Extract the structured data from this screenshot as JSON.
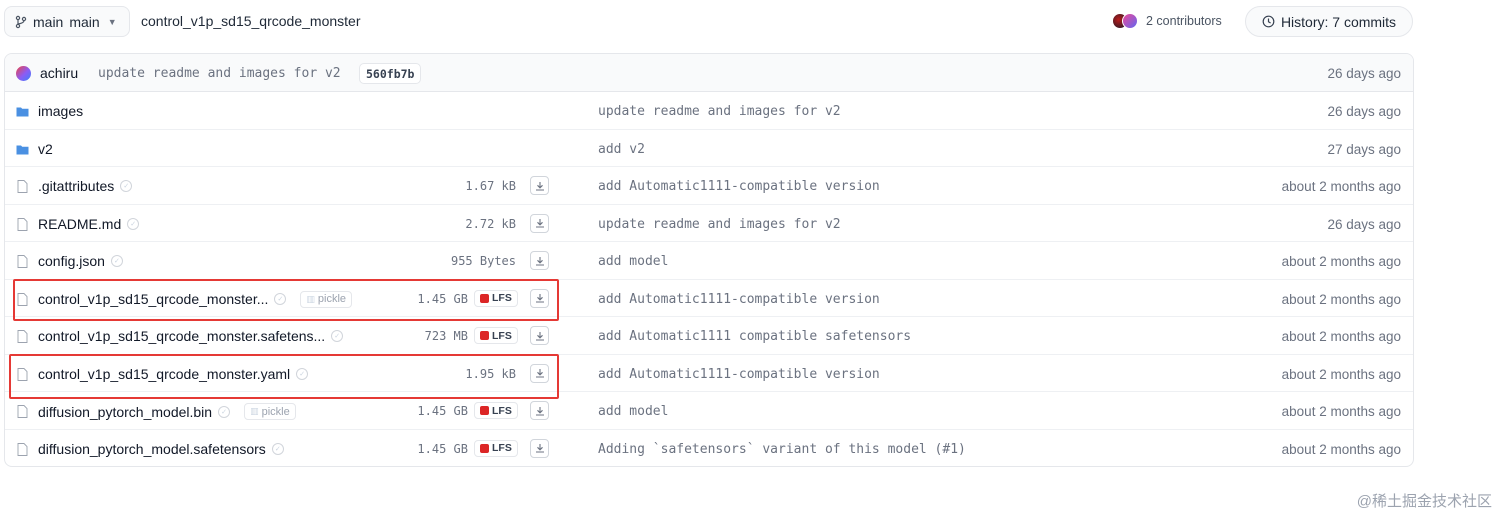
{
  "header": {
    "branch_label": "main",
    "repo_path": "control_v1p_sd15_qrcode_monster",
    "contributors_label": "2 contributors",
    "history_label": "History: 7 commits"
  },
  "last_commit": {
    "author": "achiru",
    "message": "update readme and images for v2",
    "hash": "560fb7b",
    "date": "26 days ago"
  },
  "files": [
    {
      "type": "folder",
      "name": "images",
      "message": "update readme and images for v2",
      "date": "26 days ago"
    },
    {
      "type": "folder",
      "name": "v2",
      "message": "add v2",
      "date": "27 days ago"
    },
    {
      "type": "file",
      "name": ".gitattributes",
      "size": "1.67 kB",
      "message": "add Automatic1111-compatible version",
      "date": "about 2 months ago"
    },
    {
      "type": "file",
      "name": "README.md",
      "size": "2.72 kB",
      "message": "update readme and images for v2",
      "date": "26 days ago"
    },
    {
      "type": "file",
      "name": "config.json",
      "size": "955 Bytes",
      "message": "add model",
      "date": "about 2 months ago"
    },
    {
      "type": "file",
      "name": "control_v1p_sd15_qrcode_monster...",
      "pickle": "pickle",
      "size": "1.45 GB",
      "lfs": "LFS",
      "message": "add Automatic1111-compatible version",
      "date": "about 2 months ago"
    },
    {
      "type": "file",
      "name": "control_v1p_sd15_qrcode_monster.safetens...",
      "size": "723 MB",
      "lfs": "LFS",
      "message": "add Automatic1111 compatible safetensors",
      "date": "about 2 months ago"
    },
    {
      "type": "file",
      "name": "control_v1p_sd15_qrcode_monster.yaml",
      "size": "1.95 kB",
      "message": "add Automatic1111-compatible version",
      "date": "about 2 months ago"
    },
    {
      "type": "file",
      "name": "diffusion_pytorch_model.bin",
      "pickle": "pickle",
      "size": "1.45 GB",
      "lfs": "LFS",
      "message": "add model",
      "date": "about 2 months ago"
    },
    {
      "type": "file",
      "name": "diffusion_pytorch_model.safetensors",
      "size": "1.45 GB",
      "lfs": "LFS",
      "message": "Adding `safetensors` variant of this model (#1)",
      "date": "about 2 months ago"
    }
  ],
  "watermark": "@稀土掘金技术社区",
  "colors": {
    "highlight": "#e53935",
    "folder": "#4a90e2",
    "lfs": "#dc2626"
  }
}
